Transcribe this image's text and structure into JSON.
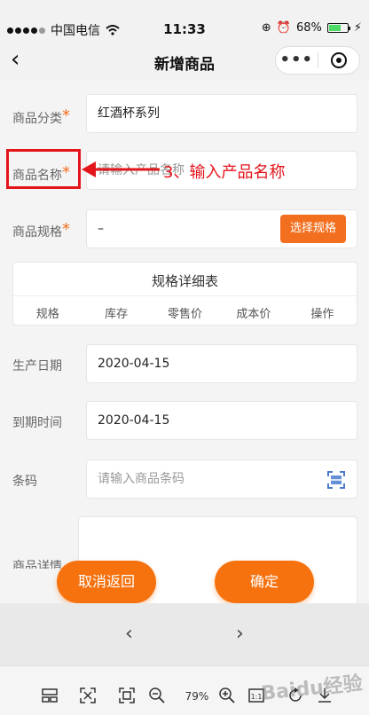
{
  "status_bar": {
    "carrier": "中国电信",
    "time": "11:33",
    "battery": "68%",
    "battery_level": 0.68
  },
  "nav": {
    "title": "新增商品",
    "more_icon": "more-dots-icon",
    "close_icon": "target-icon"
  },
  "form": {
    "category": {
      "label": "商品分类",
      "value": "红酒杯系列"
    },
    "name": {
      "label": "商品名称",
      "placeholder": "请输入产品名称"
    },
    "spec": {
      "label": "商品规格",
      "value": "–",
      "button": "选择规格"
    },
    "spec_table": {
      "title": "规格详细表",
      "headers": [
        "规格",
        "库存",
        "零售价",
        "成本价",
        "操作"
      ]
    },
    "production_date": {
      "label": "生产日期",
      "value": "2020-04-15"
    },
    "expiry_date": {
      "label": "到期时间",
      "value": "2020-04-15"
    },
    "barcode": {
      "label": "条码",
      "placeholder": "请输入商品条码"
    },
    "detail": {
      "label": "商品详情"
    }
  },
  "annotation": {
    "text": "3、输入产品名称",
    "color": "#e4141b"
  },
  "actions": {
    "cancel": "取消返回",
    "confirm": "确定",
    "accent": "#f5720f"
  },
  "browser": {
    "prev": "‹",
    "next": "›",
    "zoom": "79%"
  },
  "watermark": "Baidu经验"
}
